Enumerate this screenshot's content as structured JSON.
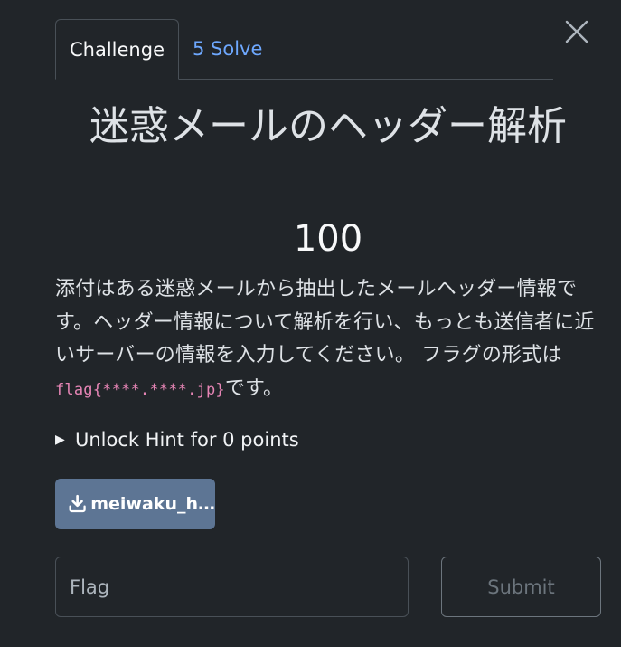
{
  "modal": {
    "close_icon": "close-icon",
    "tabs": [
      {
        "label": "Challenge",
        "active": true
      },
      {
        "label": "5 Solve",
        "active": false
      }
    ],
    "title": "迷惑メールのヘッダー解析",
    "points": "100",
    "description": {
      "text_before": "添付はある迷惑メールから抽出したメールヘッダー情報です。ヘッダー情報について解析を行い、もっとも送信者に近いサーバーの情報を入力してください。 フラグの形式は",
      "code": "flag{****.****.jp}",
      "text_after": "です。"
    },
    "hint": {
      "icon": "triangle-right-icon",
      "label": "Unlock Hint for 0 points"
    },
    "file": {
      "icon": "download-icon",
      "label": "meiwaku_h…"
    },
    "flag_input": {
      "placeholder": "Flag",
      "value": ""
    },
    "submit_label": "Submit"
  },
  "colors": {
    "background": "#212529",
    "tab_link": "#6ea8fe",
    "file_button": "#5d7594",
    "code_text": "#e685b5"
  }
}
